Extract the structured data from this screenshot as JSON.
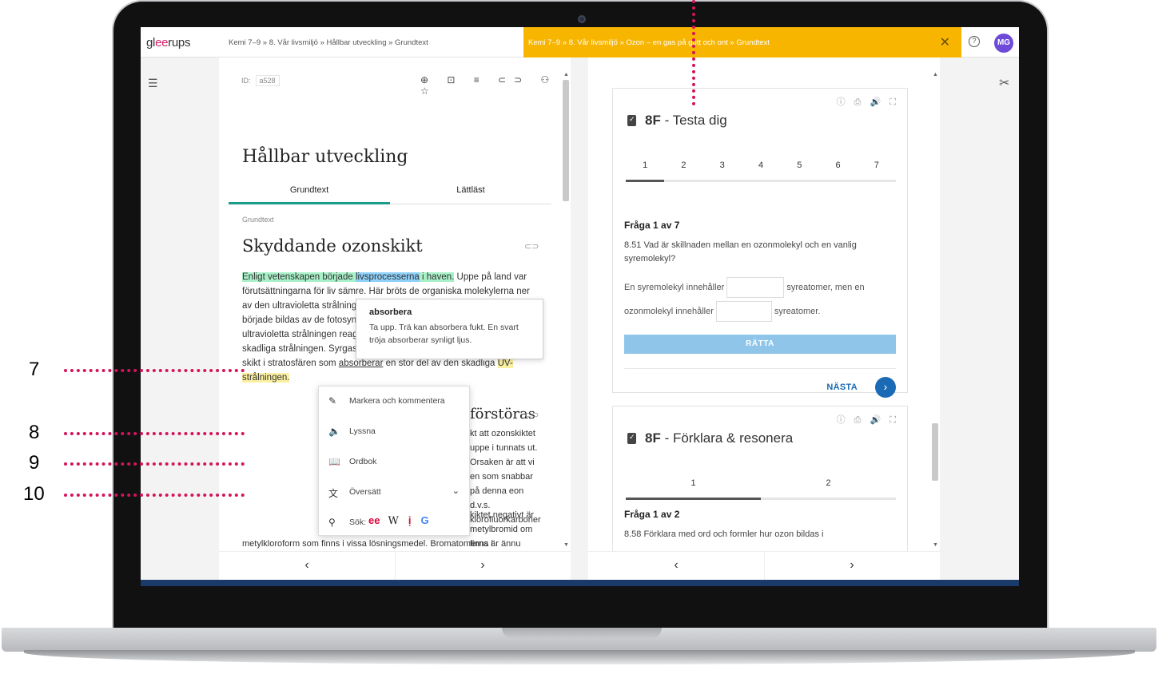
{
  "topbar": {
    "logo_a": "gl",
    "logo_ee": "ee",
    "logo_b": "rups",
    "breadcrumb_left": "Kemi 7–9  »  8. Vår livsmiljö  »  Hållbar utveckling  »  Grundtext",
    "breadcrumb_right": "Kemi 7–9  »  8. Vår livsmiljö  »  Ozon – en gas på gott och ont  »  Grundtext",
    "close_glyph": "✕",
    "help_glyph": "?",
    "avatar_initials": "MG"
  },
  "left": {
    "id_label": "ID:",
    "id_value": "a528",
    "toolbar_icons": "⊕ ⊡ ≡ ⊂⊃ ⚇ ☆",
    "title": "Hållbar utveckling",
    "tabs": [
      "Grundtext",
      "Lättläst"
    ],
    "crumb": "Grundtext",
    "subtitle": "Skyddande ozonskikt",
    "para1_green1": "Enligt vetenskapen började ",
    "para1_blue": "livsprocesserna",
    "para1_green2": " i haven.",
    "para1_rest": " Uppe på land var förutsättningarna för liv sämre. Här bröts de organiska molekylerna ner av den ultravioletta strålningen från solen. När så småningom syrgas började bildas av de fotosyntetiserande gröna bakterierna började den ultravioletta strålningen reagera med syret och omvandlade den skadliga strålningen. Syrgas omvandlades till ozon, som bildade ett tunt skikt i stratosfären som ",
    "para1_underline": "absorberar",
    "para1_rest2": " en stor del av den skadliga ",
    "para1_yellow": "UV-strålningen.",
    "tooltip_title": "absorbera",
    "tooltip_body": "Ta upp. Trä kan absorbera fukt. En svart tröja absorberar synligt ljus.",
    "subtitle2": "förstöras",
    "para2": "kt att ozonskiktet uppe i tunnats ut. Orsaken är att vi en som snabbar på denna eon d.v.s. klorofluorkarboner",
    "para3": "kiktet negativt är metylbromid om finns i halonsläckare och",
    "para4": "metylkloroform som finns i vissa lösningsmedel. Bromatomerna är ännu effektivare nedbrytare av ozon än vad klor är."
  },
  "context_menu": {
    "items": [
      {
        "icon": "✎",
        "label": "Markera och kommentera"
      },
      {
        "icon": "🔈",
        "label": "Lyssna"
      },
      {
        "icon": "📖",
        "label": "Ordbok"
      },
      {
        "icon": "文",
        "label": "Översätt",
        "chevron": "⌄"
      },
      {
        "icon": "⚲",
        "label": "Sök:"
      }
    ],
    "search_ee": "ee",
    "search_w": "W",
    "search_i": "ị",
    "search_g": "G"
  },
  "right": {
    "card1": {
      "tools": "ⓘ ⎙ 🔊 ⛶",
      "title_bold": "8F",
      "title_rest": " - Testa dig",
      "steps": [
        "1",
        "2",
        "3",
        "4",
        "5",
        "6",
        "7"
      ],
      "progress_fraction": 0.143,
      "question_head": "Fråga 1 av 7",
      "question_text": "8.51 Vad är skillnaden mellan en ozonmolekyl och en vanlig syremolekyl?",
      "fill1_a": "En syremolekyl innehåller",
      "fill1_b": "syreatomer, men en",
      "fill2_a": "ozonmolekyl innehåller",
      "fill2_b": "syreatomer.",
      "check_label": "RÄTTA",
      "next_label": "NÄSTA",
      "next_glyph": "›"
    },
    "card2": {
      "tools": "ⓘ ⎙ 🔊 ⛶",
      "title_bold": "8F",
      "title_rest": " - Förklara & resonera",
      "steps": [
        "1",
        "2"
      ],
      "progress_fraction": 0.5,
      "question_head": "Fråga 1 av 2",
      "question_text": "8.58 Förklara med ord och formler hur ozon bildas i"
    }
  },
  "nav": {
    "prev": "‹",
    "next": "›"
  },
  "side": {
    "menu_glyph": "☰",
    "tools_glyph": "✂"
  },
  "annotations": {
    "n7": "7",
    "n8": "8",
    "n9": "9",
    "n10": "10"
  },
  "colors": {
    "accent_teal": "#1a9c8c",
    "banner_yellow": "#f7b500",
    "link_blue": "#1a6ab5",
    "annotation_pink": "#d4145a"
  }
}
